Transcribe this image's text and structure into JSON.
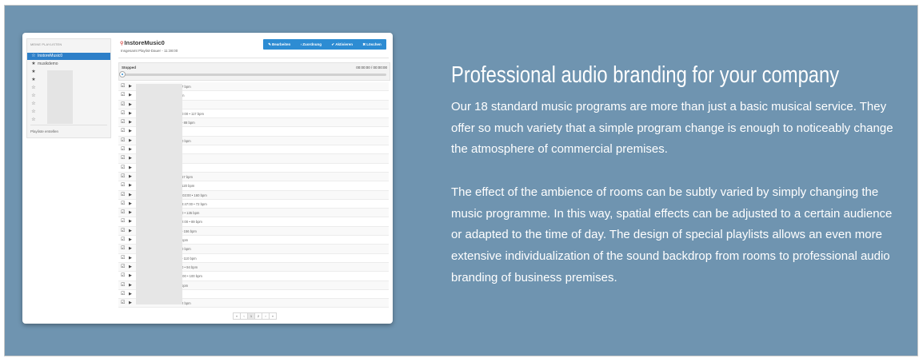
{
  "app": {
    "sidebar": {
      "header": "MEINE PLAYLISTEN",
      "items": [
        {
          "label": "InstoreMusic0",
          "icon": "star-outline-icon",
          "active": true
        },
        {
          "label": "musikdemo",
          "icon": "star-filled-icon"
        },
        {
          "label": "",
          "icon": "star-filled-icon"
        },
        {
          "label": "",
          "icon": "star-filled-icon"
        },
        {
          "label": "",
          "icon": "star-outline-icon"
        },
        {
          "label": "",
          "icon": "star-outline-icon"
        },
        {
          "label": "",
          "icon": "star-outline-icon"
        },
        {
          "label": "",
          "icon": "star-outline-icon"
        },
        {
          "label": "",
          "icon": "star-outline-icon"
        }
      ],
      "create_label": "Playliste erstellen"
    },
    "header": {
      "title": "InstoreMusic0",
      "subtitle": "Insgesamt Playlist-Dauer - 11:38:00",
      "buttons": {
        "edit": "Bearbeiten",
        "assign": "Zuordnung",
        "activate": "Aktivieren",
        "delete": "Löschen"
      }
    },
    "player": {
      "status": "Stopped",
      "time": "00:00:00 / 00:00:00",
      "progress": 0
    },
    "tracks": [
      "7 bpm",
      "m",
      "",
      "0:00 • 117 bpm",
      "• 88 bpm",
      "",
      "0 bpm",
      "",
      "",
      "",
      "67 bpm",
      "120 bpm",
      ":03:00 • 160 bpm",
      "3:47:00 • 72 bpm",
      "0 • 135 bpm",
      "2:00 • 89 bpm",
      "• 156 bpm",
      "opm",
      "0 bpm",
      "• 110 bpm",
      "0 • 94 bpm",
      ":00 • 100 bpm",
      "bpm",
      "",
      "2 bpm"
    ],
    "pager": [
      "«",
      "‹",
      "1",
      "2",
      "›",
      "»"
    ]
  },
  "content": {
    "heading": "Professional audio branding for your company",
    "paragraph1": "Our 18 standard music programs are more than just a basic musical service. They offer so much variety that a simple program change is enough to noticeably change the atmosphere of commercial premises.",
    "paragraph2": "The effect of the ambience of rooms can be subtly varied by simply changing the music programme. In this way, spatial effects can be adjusted to a certain audience or adapted to the time of day. The design of special playlists allows an even more extensive individualization of the sound backdrop from rooms to professional audio branding of business premises."
  },
  "colors": {
    "background": "#6f94b0",
    "accent": "#2d8cd3",
    "active_item": "#2d7fc8",
    "text": "#ffffff"
  }
}
